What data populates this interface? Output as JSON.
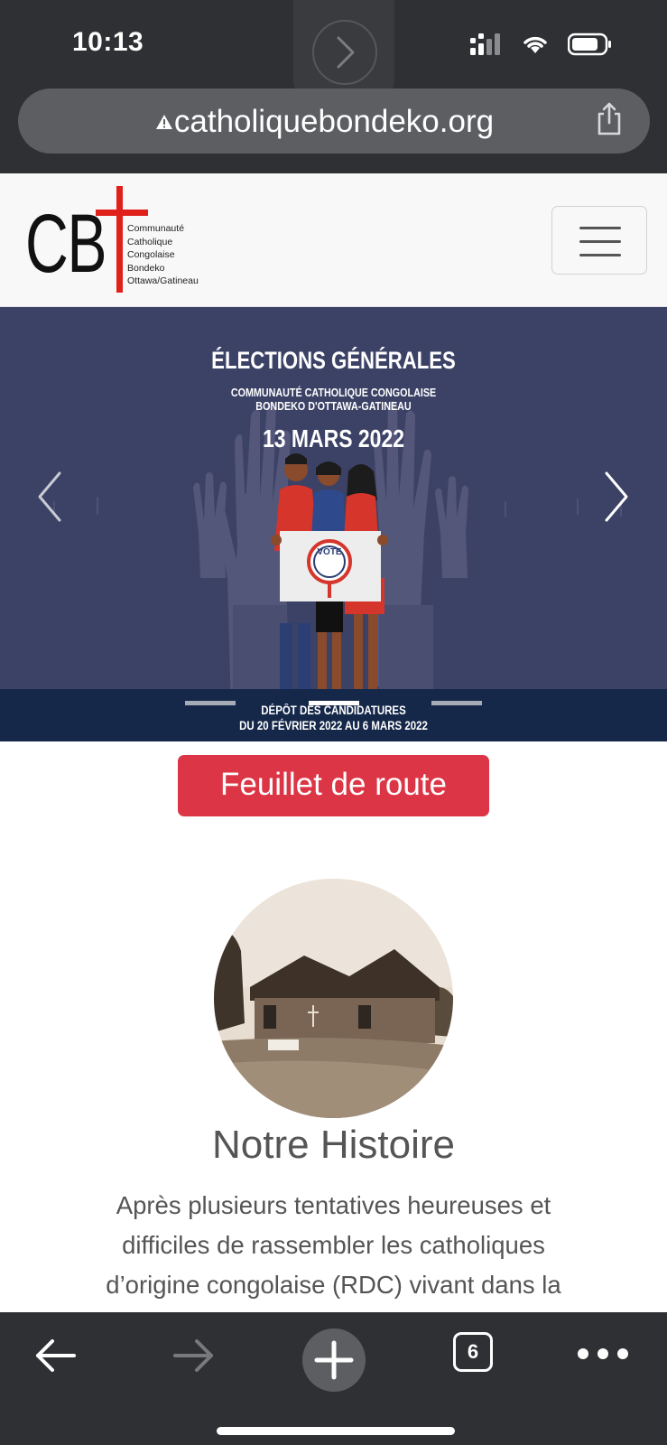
{
  "status_bar": {
    "time": "10:13",
    "icons": [
      "signal-icon",
      "wifi-icon",
      "battery-icon"
    ]
  },
  "browser": {
    "url": "catholiquebondeko.org",
    "tab_count": "6"
  },
  "header": {
    "logo_letters": "CB",
    "logo_lines": [
      "Communauté",
      "Catholique",
      "Congolaise",
      "Bondeko",
      "Ottawa/Gatineau"
    ],
    "logo_cross_color": "#e0201b",
    "menu_icon": "hamburger-icon"
  },
  "carousel": {
    "slide": {
      "title": "ÉLECTIONS GÉNÉRALES",
      "subtitle_line1": "COMMUNAUTÉ  CATHOLIQUE CONGOLAISE",
      "subtitle_line2": "BONDEKO D'OTTAWA-GATINEAU",
      "date": "13 MARS 2022",
      "sign_text": "VOTE",
      "footer_line1": "DÉPÔT DES CANDIDATURES",
      "footer_line2": "DU 20 FÉVRIER 2022 AU 6 MARS 2022"
    },
    "indicator_count": 3,
    "active_indicator": 1,
    "background_color": "#3c4266"
  },
  "cta": {
    "label": "Feuillet de route",
    "color": "#dc3545"
  },
  "history": {
    "title": "Notre Histoire",
    "lines": [
      "Après plusieurs tentatives heureuses et",
      "difficiles de rassembler les catholiques",
      "d’origine congolaise (RDC) vivant dans la"
    ]
  }
}
